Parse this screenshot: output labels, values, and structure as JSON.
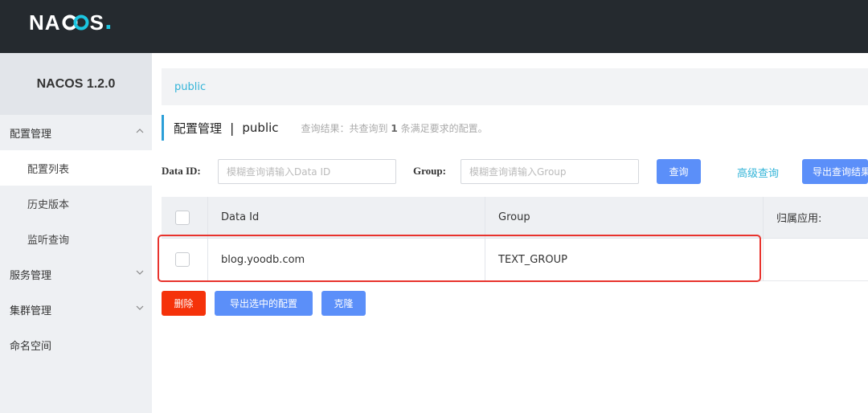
{
  "app": {
    "logo_left": "NA",
    "logo_right": "S",
    "logo_dot": ".",
    "version": "NACOS 1.2.0"
  },
  "sidebar": {
    "groups": [
      {
        "label": "配置管理",
        "expanded": true,
        "items": [
          {
            "label": "配置列表",
            "active": true
          },
          {
            "label": "历史版本",
            "active": false
          },
          {
            "label": "监听查询",
            "active": false
          }
        ]
      },
      {
        "label": "服务管理",
        "expanded": false
      },
      {
        "label": "集群管理",
        "expanded": false
      },
      {
        "label": "命名空间"
      }
    ]
  },
  "namespace_bar": {
    "label": "public"
  },
  "title": {
    "main": "配置管理",
    "sep": "|",
    "namespace": "public",
    "hint_prefix": "查询结果：共查询到",
    "hint_count": "1",
    "hint_suffix": "条满足要求的配置。"
  },
  "filters": {
    "data_id_label": "Data ID:",
    "data_id_placeholder": "模糊查询请输入Data ID",
    "group_label": "Group:",
    "group_placeholder": "模糊查询请输入Group",
    "query_button": "查询",
    "advanced_link": "高级查询",
    "export_button": "导出查询结果"
  },
  "table": {
    "columns": [
      "Data Id",
      "Group",
      "归属应用:"
    ],
    "rows": [
      {
        "data_id": "blog.yoodb.com",
        "group": "TEXT_GROUP",
        "app": ""
      }
    ]
  },
  "actions": {
    "delete": "删除",
    "export_selected": "导出选中的配置",
    "clone": "克隆"
  },
  "colors": {
    "topbar": "#252a2f",
    "accent_blue": "#5b8ff9",
    "link_cyan": "#33b4d8",
    "danger": "#f5320a",
    "highlight_red": "#e8332d"
  }
}
